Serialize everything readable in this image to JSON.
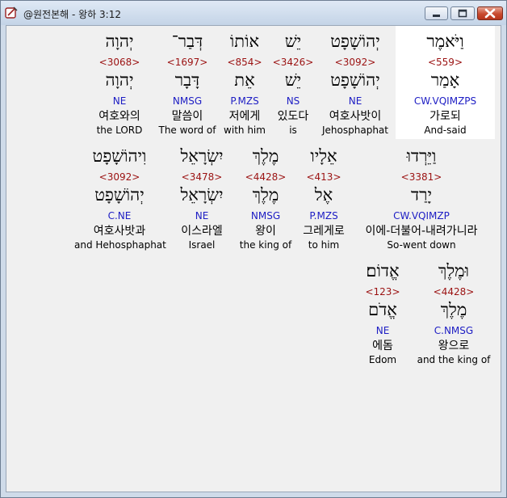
{
  "window": {
    "title": "@원전본해 - 왕하 3:12",
    "icon": "app-icon",
    "buttons": [
      "minimize-icon",
      "maximize-icon",
      "close-icon"
    ]
  },
  "rows": [
    [
      {
        "heb": "יְהוָה",
        "strong": "<3068>",
        "lemma": "יְהוָה",
        "morph": "NE",
        "kor": "여호와의",
        "eng": "the LORD"
      },
      {
        "heb": "דְּבַר־",
        "strong": "<1697>",
        "lemma": "דָּבָר",
        "morph": "NMSG",
        "kor": "말씀이",
        "eng": "The word of"
      },
      {
        "heb": "אוֹתוֹ",
        "strong": "<854>",
        "lemma": "אֵת",
        "morph": "P.MZS",
        "kor": "저에게",
        "eng": "with him"
      },
      {
        "heb": "יֵשׁ",
        "strong": "<3426>",
        "lemma": "יֵשׁ",
        "morph": "NS",
        "kor": "있도다",
        "eng": "is"
      },
      {
        "heb": "יְהוֹשָׁפָט",
        "strong": "<3092>",
        "lemma": "יְהוֹשָׁפָט",
        "morph": "NE",
        "kor": "여호사밧이",
        "eng": "Jehosphaphat"
      },
      {
        "heb": "וַיֹּאמֶר",
        "strong": "<559>",
        "lemma": "אָמַר",
        "morph": "CW.VQIMZPS",
        "kor": "가로되",
        "eng": "And-said"
      }
    ],
    [
      {
        "heb": "וִיהוֹשָׁפָט",
        "strong": "<3092>",
        "lemma": "יְהוֹשָׁפָט",
        "morph": "C.NE",
        "kor": "여호사밧과",
        "eng": "and Hehosphaphat"
      },
      {
        "heb": "יִשְׂרָאֵל",
        "strong": "<3478>",
        "lemma": "יִשְׂרָאֵל",
        "morph": "NE",
        "kor": "이스라엘",
        "eng": "Israel"
      },
      {
        "heb": "מֶלֶךְ",
        "strong": "<4428>",
        "lemma": "מֶלֶךְ",
        "morph": "NMSG",
        "kor": "왕이",
        "eng": "the king of"
      },
      {
        "heb": "אֵלָיו",
        "strong": "<413>",
        "lemma": "אֶל",
        "morph": "P.MZS",
        "kor": "그레게로",
        "eng": "to him"
      },
      {
        "heb": "וַיֵּרְדוּ",
        "strong": "<3381>",
        "lemma": "יָרַד",
        "morph": "CW.VQIMZP",
        "kor": "이에-더불어-내려가니라",
        "eng": "So-went down"
      }
    ],
    [
      {
        "heb": "אֱדוֹם׃",
        "strong": "<123>",
        "lemma": "אֱדֹם",
        "morph": "NE",
        "kor": "에돔",
        "eng": "Edom"
      },
      {
        "heb": "וּמֶלֶךְ",
        "strong": "<4428>",
        "lemma": "מֶלֶךְ",
        "morph": "C.NMSG",
        "kor": "왕으로",
        "eng": "and the king of"
      }
    ]
  ],
  "colors": {
    "strong": "#9b1212",
    "morph": "#1d1dc4",
    "client_bg": "#f0f0f0",
    "selected_bg": "#ffffff"
  }
}
